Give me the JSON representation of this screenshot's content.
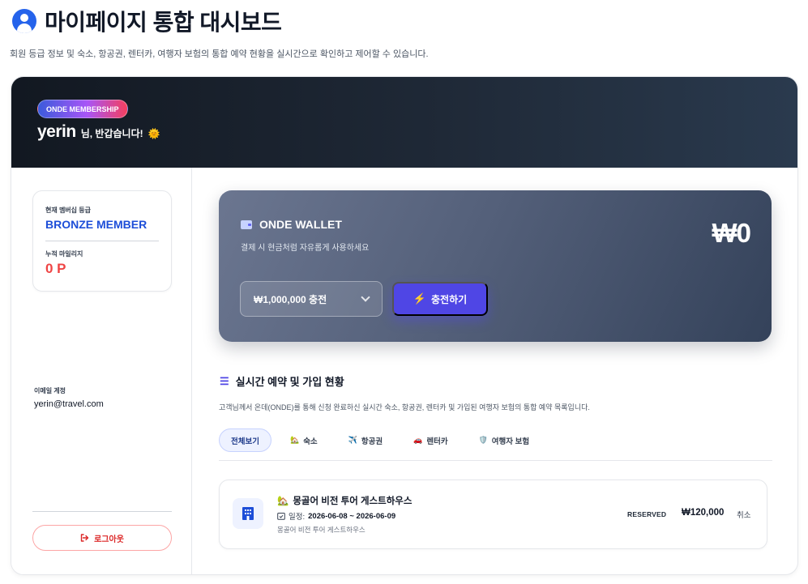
{
  "header": {
    "title": "마이페이지 통합 대시보드",
    "subtitle": "회원 등급 정보 및 숙소, 항공권, 렌터카, 여행자 보험의 통합 예약 현황을 실시간으로 확인하고 제어할 수 있습니다.",
    "icon": "user-circle-icon"
  },
  "banner": {
    "membership_badge": "ONDE MEMBERSHIP",
    "username": "yerin",
    "greeting": "님, 반갑습니다!",
    "greeting_emoji": "🌞"
  },
  "sidebar": {
    "grade_label": "현재 멤버십 등급",
    "grade_value": "BRONZE MEMBER",
    "mileage_label": "누적 마일리지",
    "mileage_value": "0 P",
    "email_label": "이메일 계정",
    "email_value": "yerin@travel.com",
    "logout_label": "로그아웃"
  },
  "wallet": {
    "title": "ONDE WALLET",
    "description": "결제 시 현금처럼 자유롭게 사용하세요",
    "balance": "₩0",
    "amount_selected": "₩1,000,000 충전",
    "charge_label": "충전하기"
  },
  "reservations": {
    "title": "실시간 예약 및 가입 현황",
    "description": "고객님께서 온데(ONDE)를 통해 신청 완료하신 실시간 숙소, 항공권, 렌터카 및 가입된 여행자 보험의 통합 예약 목록입니다.",
    "tabs": [
      {
        "label": "전체보기",
        "icon": "",
        "active": true
      },
      {
        "label": "숙소",
        "icon": "🏡",
        "active": false
      },
      {
        "label": "항공권",
        "icon": "✈️",
        "active": false
      },
      {
        "label": "렌터카",
        "icon": "🚗",
        "active": false
      },
      {
        "label": "여행자 보험",
        "icon": "🛡️",
        "active": false
      }
    ],
    "items": [
      {
        "emoji": "🏡",
        "name": "몽골어 비전 투어 게스트하우스",
        "date_label": "일정:",
        "date_value": "2026-06-08 ~ 2026-06-09",
        "subtitle": "몽골어 비전 투어 게스트하우스",
        "status": "RESERVED",
        "price": "₩120,000",
        "cancel_label": "취소"
      }
    ]
  },
  "colors": {
    "accent": "#4f46e5",
    "grade": "#1d4ed8",
    "mileage": "#ef4444",
    "logout": "#dc2626",
    "banner_dark": "#121821"
  }
}
